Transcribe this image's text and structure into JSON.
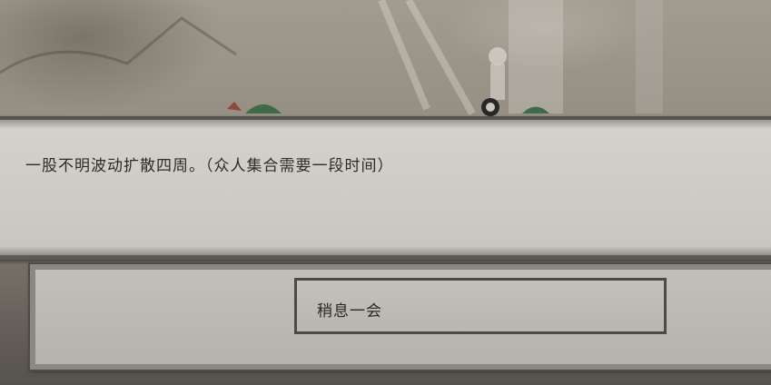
{
  "dialog": {
    "narrative": "一股不明波动扩散四周。（众人集合需要一段时间）"
  },
  "choices": [
    {
      "label": "稍息一会"
    }
  ]
}
